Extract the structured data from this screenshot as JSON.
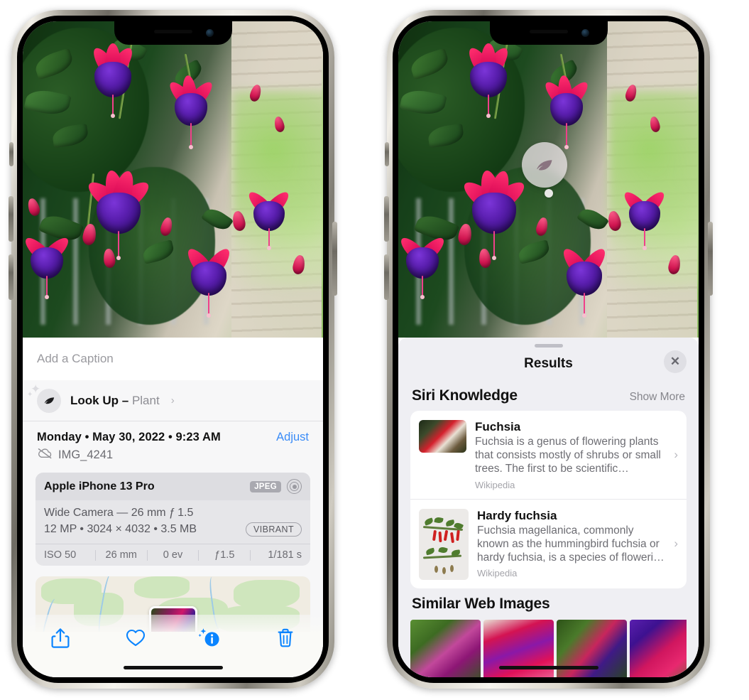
{
  "left_phone": {
    "caption": {
      "placeholder": "Add a Caption",
      "value": ""
    },
    "look_up": {
      "label": "Look Up",
      "dash": "–",
      "subject": "Plant",
      "chevron": "›",
      "icon": "leaf-icon"
    },
    "date_line": "Monday • May 30, 2022 • 9:23 AM",
    "adjust_label": "Adjust",
    "file_name": "IMG_4241",
    "cloud_icon": "cloud-slash-icon",
    "metadata": {
      "device": "Apple iPhone 13 Pro",
      "format_badge": "JPEG",
      "aperture_icon": "aperture-icon",
      "lens_line": "Wide Camera — 26 mm ƒ 1.5",
      "size_line": "12 MP • 3024 × 4032 • 3.5 MB",
      "style_badge": "VIBRANT",
      "exif": [
        "ISO 50",
        "26 mm",
        "0 ev",
        "ƒ1.5",
        "1/181 s"
      ]
    },
    "toolbar": [
      {
        "name": "share-button",
        "icon": "share-icon"
      },
      {
        "name": "favorite-button",
        "icon": "heart-icon"
      },
      {
        "name": "info-button",
        "icon": "info-sparkle-icon"
      },
      {
        "name": "delete-button",
        "icon": "trash-icon"
      }
    ]
  },
  "right_phone": {
    "visual_lookup_badge": {
      "icon": "leaf-icon"
    },
    "sheet": {
      "title": "Results",
      "close_icon": "✕",
      "siri_knowledge": {
        "heading": "Siri Knowledge",
        "show_more": "Show More",
        "results": [
          {
            "title": "Fuchsia",
            "description": "Fuchsia is a genus of flowering plants that consists mostly of shrubs or small trees. The first to be scientific…",
            "source": "Wikipedia",
            "chevron": "›"
          },
          {
            "title": "Hardy fuchsia",
            "description": "Fuchsia magellanica, commonly known as the hummingbird fuchsia or hardy fuchsia, is a species of floweri…",
            "source": "Wikipedia",
            "chevron": "›"
          }
        ]
      },
      "similar_web_images": {
        "heading": "Similar Web Images",
        "count": 4
      }
    }
  },
  "colors": {
    "accent_blue": "#0a84ff",
    "link_blue": "#3b8cf7",
    "sheet_bg": "#efeff3",
    "card_bg": "#ffffff",
    "meta_card_bg": "#e6e6e9",
    "secondary_text": "#6d6d73"
  }
}
